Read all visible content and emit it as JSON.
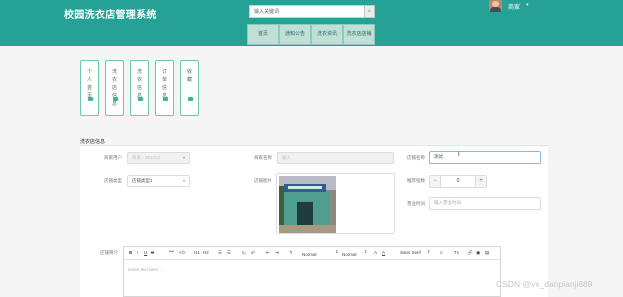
{
  "app": {
    "title": "校园洗衣店管理系统"
  },
  "header": {
    "search_placeholder": "输入关键词",
    "search_button_icon": "search-icon",
    "user": {
      "name": "商家",
      "dropdown_icon": "caret-down-icon"
    },
    "nav": [
      {
        "label": "首页"
      },
      {
        "label": "通知公告"
      },
      {
        "label": "洗衣资讯"
      },
      {
        "label": "洗衣店店铺"
      }
    ]
  },
  "quick_links": [
    {
      "label": "个人首页",
      "icon": "home-icon"
    },
    {
      "label": "洗衣店信息",
      "icon": "home-icon"
    },
    {
      "label": "洗衣信息",
      "icon": "home-icon"
    },
    {
      "label": "订单信息",
      "icon": "home-icon"
    },
    {
      "label": "收藏",
      "icon": "home-icon"
    }
  ],
  "form": {
    "section_title": "洗衣店信息",
    "merchant_user": {
      "label": "商家用户",
      "value": "商家 - 001212"
    },
    "merchant_name": {
      "label": "商家名称",
      "value": "输入"
    },
    "shop_name": {
      "label": "店铺名称",
      "value": "测试"
    },
    "shop_type": {
      "label": "店铺类型",
      "value": "店铺类型1"
    },
    "shop_image": {
      "label": "店铺图片"
    },
    "recommend_index": {
      "label": "推荐指数",
      "value": "0",
      "minus": "−",
      "plus": "+"
    },
    "business_hours": {
      "label": "营业时间",
      "placeholder": "输入营业时间"
    },
    "shop_intro": {
      "label": "店铺简介",
      "placeholder": "Insert text here ..."
    }
  },
  "editor_toolbar": {
    "items": [
      "B",
      "I",
      "U",
      "S",
      "❝❞",
      "</>",
      "H1",
      "H2",
      "☰",
      "☰",
      "x₂",
      "x²",
      "⇤",
      "⇥",
      "↰",
      "Normal",
      "Normal",
      "A",
      "A",
      "Sans Serif",
      "≡",
      "Tx",
      "🔗",
      "▣",
      "▤"
    ]
  },
  "colors": {
    "header": "#25a295",
    "accent": "#36b79a",
    "nav_bg": "#bfe0d7"
  },
  "watermark": "CSDN @vx_danpianji889"
}
